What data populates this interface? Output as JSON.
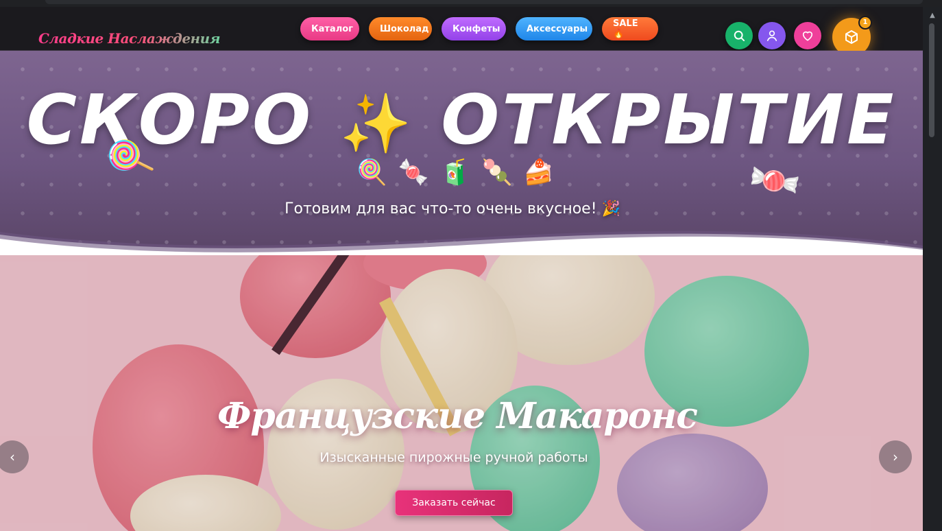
{
  "header": {
    "logo": "Сладкие Наслаждения",
    "nav": [
      "Каталог",
      "Шоколад",
      "Конфеты",
      "Аксессуары",
      "SALE 🔥"
    ],
    "cart_count": "1"
  },
  "banner": {
    "title_left": "СКОРО",
    "title_sparkle": "✨",
    "title_right": "ОТКРЫТИЕ",
    "subtitle": "Готовим для вас что-то очень вкусное! 🎉",
    "emojis": [
      "🍭",
      "🍬",
      "🧃",
      "🍡",
      "🍰"
    ],
    "side_left": "🍭",
    "side_right": "🍬"
  },
  "hero": {
    "title": "Французские Макаронс",
    "subtitle": "Изысканные пирожные ручной работы",
    "cta": "Заказать сейчас",
    "prev": "‹",
    "next": "›"
  },
  "colors": {
    "catalog": "#ef4a94",
    "chocolate": "#f07a1e",
    "candy": "#a855f7",
    "accessories": "#2f9bf5",
    "sale": "#f45a26",
    "search": "#18b26a",
    "user": "#8557ee",
    "favorites": "#ef3f9a",
    "cart": "#f39a1a"
  }
}
